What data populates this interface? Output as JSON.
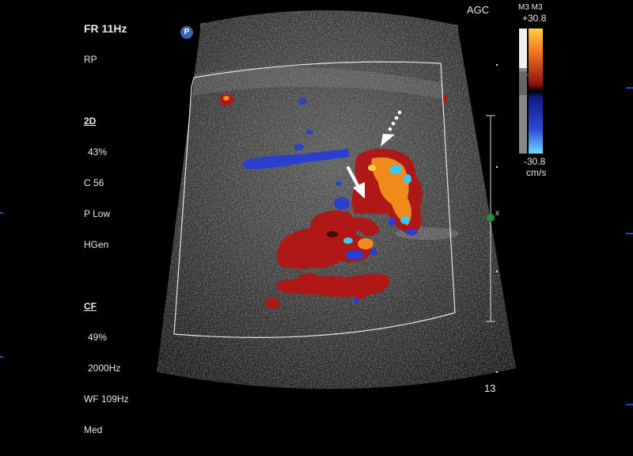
{
  "header": {
    "frame_rate": "FR 11Hz",
    "preset": "RP",
    "agc": "AGC"
  },
  "mode_2d": {
    "title": "2D",
    "gain": "43%",
    "c": "C 56",
    "p": "P Low",
    "mode": "HGen"
  },
  "mode_cf": {
    "title": "CF",
    "gain": "49%",
    "freq": "2000Hz",
    "wf": "WF 109Hz",
    "filter": "Med"
  },
  "velocity_scale": {
    "top_label": "M3 M3",
    "max": "+30.8",
    "min": "-30.8",
    "unit": "cm/s"
  },
  "depth": "13",
  "badge": "P",
  "colors": {
    "flow_red": "#b01818",
    "flow_orange": "#f08a1a",
    "flow_blue": "#2a3fd0",
    "cyan": "#3cc8f0",
    "roi_box": "#e6e6e6"
  }
}
